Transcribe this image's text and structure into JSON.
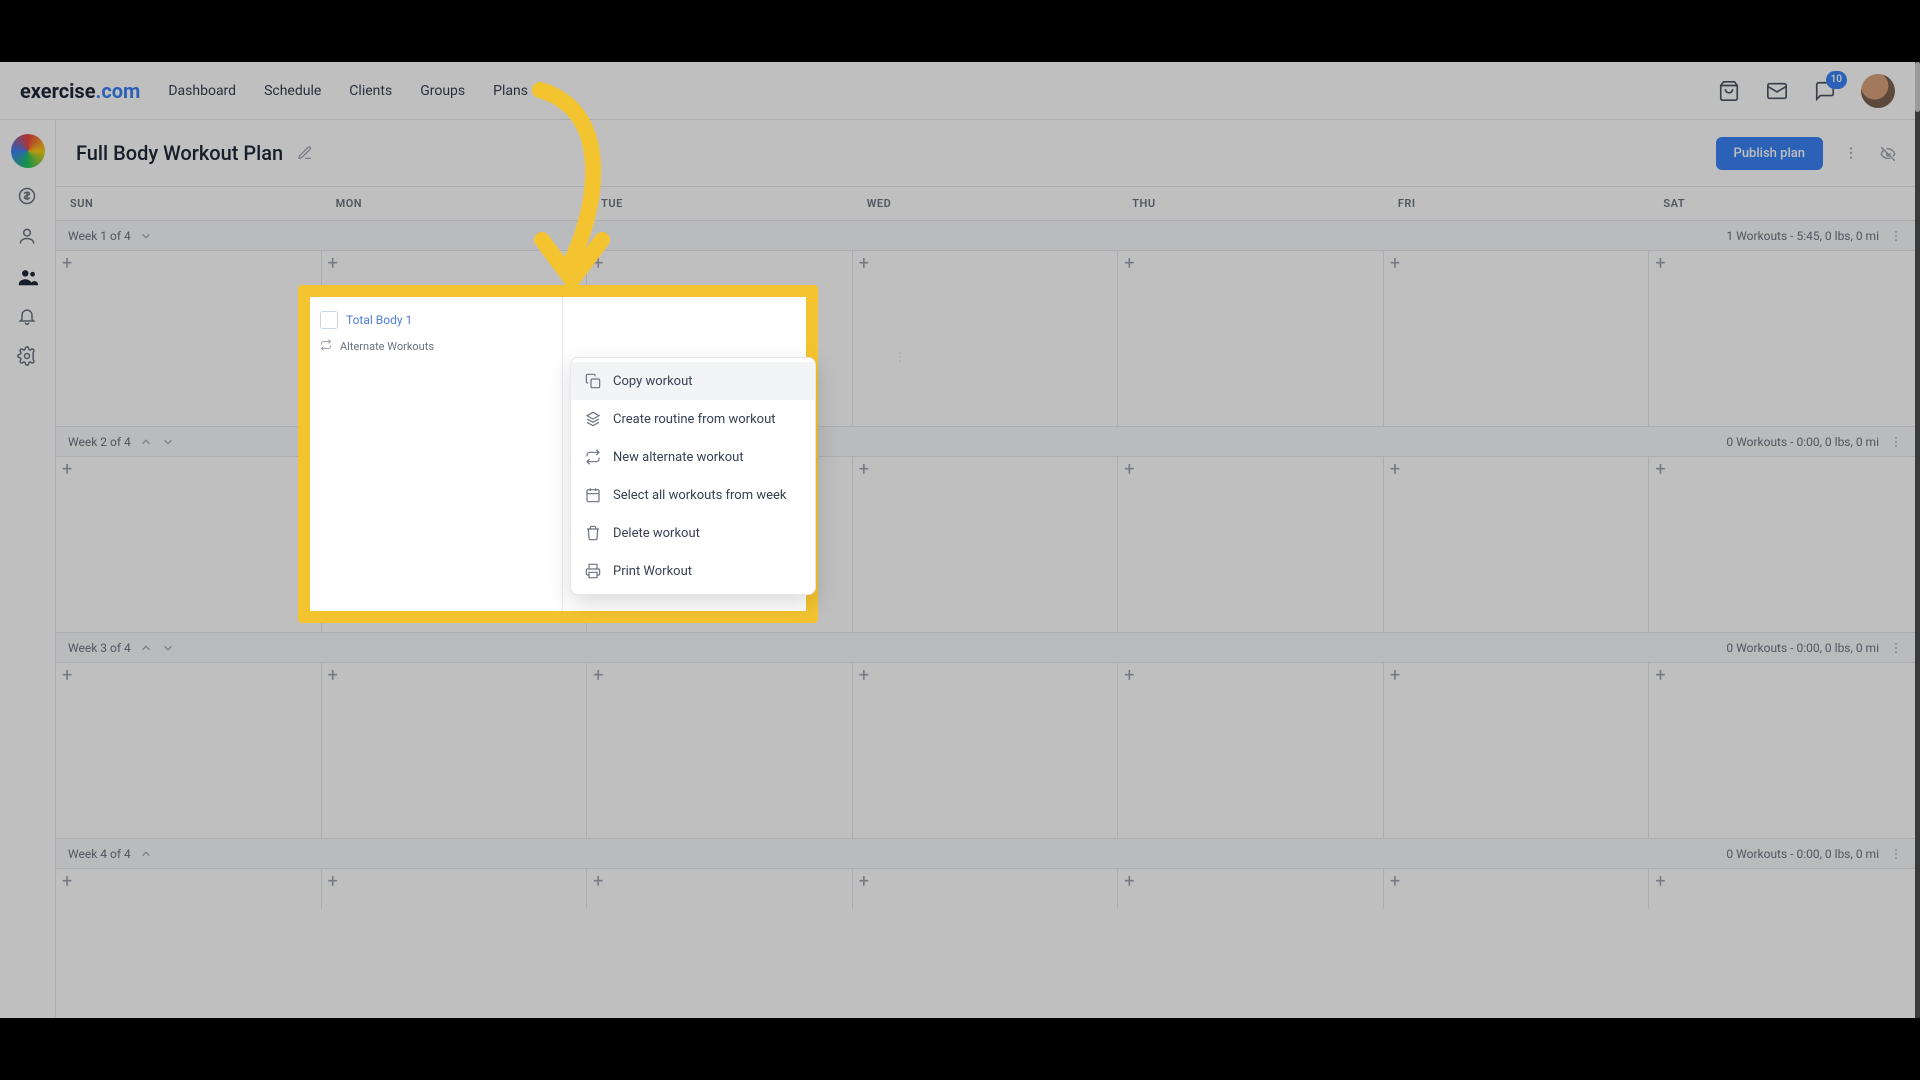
{
  "brand": {
    "part1": "exercise",
    "part2": ".com"
  },
  "nav": {
    "dashboard": "Dashboard",
    "schedule": "Schedule",
    "clients": "Clients",
    "groups": "Groups",
    "plans": "Plans"
  },
  "header_icons": {
    "chat_badge": "10"
  },
  "page": {
    "title": "Full Body Workout Plan",
    "publish_button": "Publish plan"
  },
  "days": {
    "sun": "SUN",
    "mon": "MON",
    "tue": "TUE",
    "wed": "WED",
    "thu": "THU",
    "fri": "FRI",
    "sat": "SAT"
  },
  "weeks": {
    "w1": {
      "label": "Week 1 of 4",
      "stats": "1 Workouts - 5:45, 0 lbs, 0 mi"
    },
    "w2": {
      "label": "Week 2 of 4",
      "stats": "0 Workouts - 0:00, 0 lbs, 0 mi"
    },
    "w3": {
      "label": "Week 3 of 4",
      "stats": "0 Workouts - 0:00, 0 lbs, 0 mi"
    },
    "w4": {
      "label": "Week 4 of 4",
      "stats": "0 Workouts - 0:00, 0 lbs, 0 mi"
    }
  },
  "workout_card": {
    "name": "Total Body 1",
    "alternate": "Alternate Workouts"
  },
  "menu": {
    "copy": "Copy workout",
    "create_routine": "Create routine from workout",
    "new_alternate": "New alternate workout",
    "select_all": "Select all workouts from week",
    "delete": "Delete workout",
    "print": "Print Workout"
  }
}
